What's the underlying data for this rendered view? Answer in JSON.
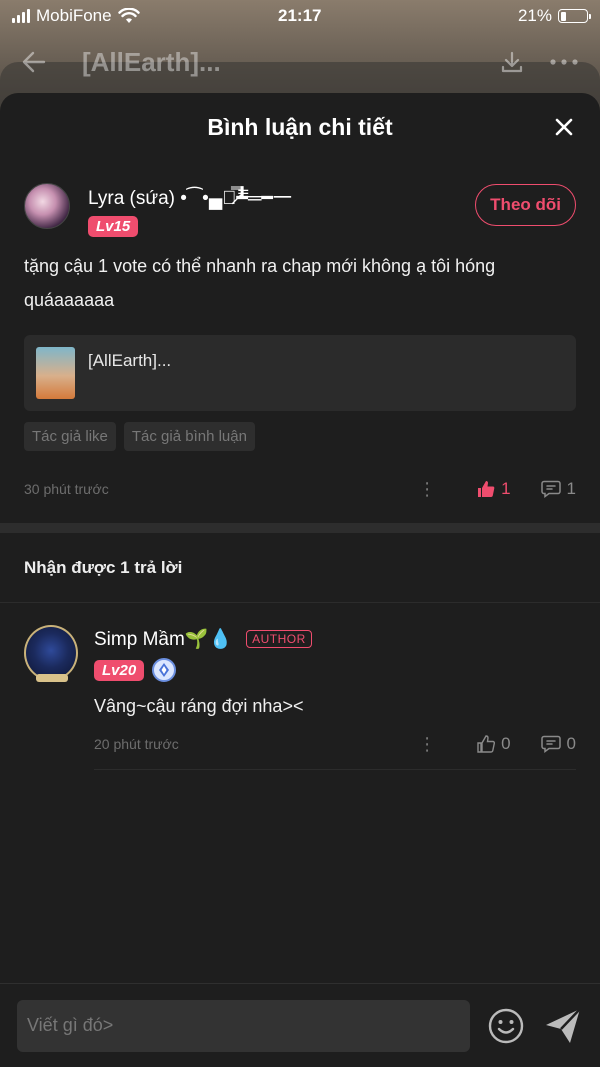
{
  "status_bar": {
    "carrier": "MobiFone",
    "time": "21:17",
    "battery": "21%",
    "battery_level": 0.21
  },
  "background": {
    "title": "[AllEarth]..."
  },
  "sheet": {
    "title": "Bình luận chi tiết"
  },
  "comment": {
    "user_name": "Lyra (sứa) •⁀•▄︻̷̿┻̿═━一",
    "level": "Lv15",
    "follow_label": "Theo dõi",
    "text": "tặng cậu 1 vote có thể nhanh ra chap mới không ạ tôi hóng quáaaaaaa",
    "ref_title": "[AllEarth]...",
    "tags": [
      "Tác giả like",
      "Tác giả bình luận"
    ],
    "time": "30 phút trước",
    "more": "⋮",
    "likes": "1",
    "replies": "1"
  },
  "replies_section": {
    "header": "Nhận được 1 trả lời"
  },
  "reply": {
    "user_name": "Simp Mầm🌱💧",
    "author_badge": "AUTHOR",
    "level": "Lv20",
    "text": "Vâng~cậu ráng đợi nha><",
    "time": "20 phút trước",
    "more": "⋮",
    "likes": "0",
    "replies": "0"
  },
  "input": {
    "placeholder": "Viết gì đó>"
  },
  "colors": {
    "accent": "#ef4d6e",
    "sheet_bg": "#1e1e1e"
  }
}
